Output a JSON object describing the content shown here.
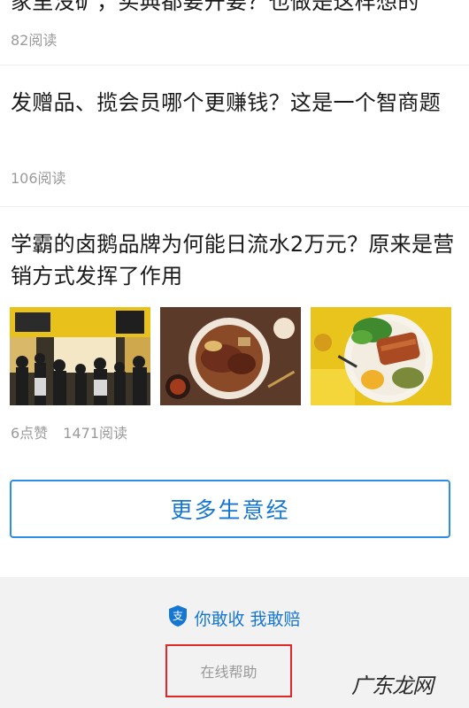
{
  "articles": [
    {
      "title": "家里没矿，买典都要开要？也做是这样想的",
      "stats": {
        "reads": "82阅读"
      }
    },
    {
      "title": "发赠品、揽会员哪个更赚钱？这是一个智商题",
      "stats": {
        "reads": "106阅读"
      }
    },
    {
      "title": "学霸的卤鹅品牌为何能日流水2万元？原来是营销方式发挥了作用",
      "stats": {
        "likes": "6点赞",
        "reads": "1471阅读"
      },
      "images": [
        {
          "icon": "storefront-queue-photo"
        },
        {
          "icon": "braised-goose-noodle-photo"
        },
        {
          "icon": "goose-rice-plate-photo"
        }
      ]
    }
  ],
  "more_button": {
    "label": "更多生意经"
  },
  "footer": {
    "slogan": "你敢收 我敢赔",
    "slogan_icon": "alipay-shield-icon",
    "help_label": "在线帮助",
    "watermark": "广东龙网"
  },
  "colors": {
    "accent": "#1677d2",
    "border": "#2d8ee6",
    "highlight": "#e02828"
  }
}
